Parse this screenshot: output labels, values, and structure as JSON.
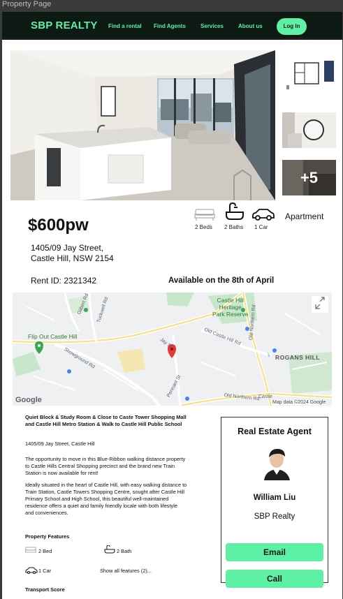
{
  "frame": {
    "label": "Property Page"
  },
  "nav": {
    "brand": "SBP REALTY",
    "links": [
      "Find a rental",
      "Find Agents",
      "Services",
      "About us"
    ],
    "login": "Log In"
  },
  "gallery": {
    "more_count": "+5"
  },
  "listing": {
    "price": "$600pw",
    "address_line1": "1405/09 Jay Street,",
    "address_line2": "Castle Hill, NSW 2154",
    "features": {
      "beds": "2 Beds",
      "baths": "2 Baths",
      "car": "1 Car"
    },
    "property_type": "Apartment",
    "rent_id": "Rent ID: 2321342",
    "availability": "Available on the 8th of April"
  },
  "map": {
    "labels": {
      "heritage": [
        "Castle Hill",
        "Heritage",
        "Park Reserve"
      ],
      "flip_out": "Flip Out Castle Hill",
      "rogans_hill": "ROGANS HILL",
      "gilbert_rd": "Gilbert Rd",
      "tuckwell_rd": "Tuckwell Rd",
      "showground_rd": "Showground Rd",
      "old_castle_hill_rd": "Old Castle Hill Rd",
      "old_northern_rd_v": "Old Northern Rd",
      "old_northern_rd_h": "Old Northern Rd",
      "pennant_st": "Pennant St",
      "jay_st": "Jay St",
      "castle": "Castle"
    },
    "google": "Google",
    "map_data": "Map data ©2024 Google",
    "colors": {
      "park": "#c8e6c9",
      "pin_red": "#e53935",
      "pin_green": "#34a853",
      "water": "#a8d1f5"
    }
  },
  "description": {
    "headline": "Quiet Block & Study Room & Close to Caste Tower Shopping Mall and Castle Hill Metro Station & Walk to Castle Hill Public School",
    "address": "1405/09 Jay Street, Castle Hill",
    "para1": "The opportunity to move in this Blue-Ribbon walking distance property to Castle Hills Central Shopping precinct and the brand new Train Station is now available for rent!",
    "para2": "Ideally situated in the heart of Castle Hill, with easy walking distance to Train Station, Castle Towers Shopping Centre, sought after Castle Hill Primary School and High School, this beautiful well-maintained residence offers a quiet and family friendly locale with both lifestyle and conveniences."
  },
  "property_features": {
    "heading": "Property Features",
    "bed": "2 Bed",
    "bath": "2 Bath",
    "car": "1 Car",
    "show_all": "Show all features (2)..."
  },
  "transport": {
    "heading": "Transport Score"
  },
  "agent": {
    "title": "Real Estate Agent",
    "name": "William Liu",
    "company": "SBP Realty",
    "email_label": "Email",
    "call_label": "Call"
  },
  "colors": {
    "accent": "#5ef0a4",
    "nav_bg": "#0d1a14"
  }
}
